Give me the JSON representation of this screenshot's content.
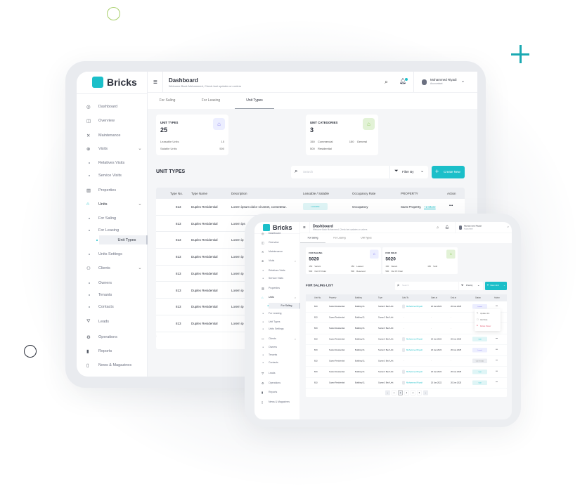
{
  "colors": {
    "accent": "#1bbfc9",
    "purple": "#8b7ff0",
    "green": "#8ccc5a",
    "danger": "#e0526a"
  },
  "decor": {
    "circle_top": "circle-outline-green",
    "plus": "plus-teal",
    "circle_left": "circle-outline-dark"
  },
  "big": {
    "brand": "Bricks",
    "header": {
      "title": "Dashboard",
      "subtitle": "Welcome Back Mohammed, Check last updates on orders",
      "user_name": "Mohammed Riyadi",
      "user_role": "Accountant"
    },
    "sidebar": [
      {
        "label": "Dashboard",
        "icon": "dashboard-icon"
      },
      {
        "label": "Overview",
        "icon": "overview-icon"
      },
      {
        "label": "Maintenance",
        "icon": "maintenance-icon"
      },
      {
        "label": "Visits",
        "icon": "visits-icon",
        "chevron": true
      },
      {
        "label": "Relatives Visits",
        "sub": true
      },
      {
        "label": "Service Visits",
        "sub": true
      },
      {
        "label": "Properties",
        "icon": "properties-icon"
      },
      {
        "label": "Units",
        "icon": "units-icon",
        "chevron": true,
        "active": true
      },
      {
        "label": "For Saling",
        "sub": true
      },
      {
        "label": "For Leasing",
        "sub": true
      },
      {
        "label": "Unit Types",
        "sub": true,
        "selected": true
      },
      {
        "label": "Units Settings",
        "sub": true
      },
      {
        "label": "Clients",
        "icon": "clients-icon",
        "chevron": true
      },
      {
        "label": "Owners",
        "sub": true
      },
      {
        "label": "Tenants",
        "sub": true
      },
      {
        "label": "Contacts",
        "sub": true
      },
      {
        "label": "Leads",
        "icon": "leads-icon"
      },
      {
        "label": "Operations",
        "icon": "operations-icon"
      },
      {
        "label": "Reports",
        "icon": "reports-icon"
      },
      {
        "label": "News & Magazines",
        "icon": "news-icon"
      }
    ],
    "tabs": [
      "For Saling",
      "For Leasing",
      "Unit Types"
    ],
    "active_tab": "Unit Types",
    "cards": [
      {
        "title": "UNIT TYPES",
        "value": "25",
        "rows": [
          [
            "Leasable Units",
            "15"
          ],
          [
            "Salable Units",
            "500"
          ]
        ]
      },
      {
        "title": "UNIT CATEGORIES",
        "value": "3",
        "rows": [
          [
            "150",
            "Commercial",
            "150",
            "General"
          ],
          [
            "500",
            "Residential"
          ]
        ]
      }
    ],
    "list_title": "UNIT TYPES",
    "search_placeholder": "Search",
    "filter_label": "Filter By",
    "create_label": "Create New",
    "columns": [
      "Type No.",
      "Type Name",
      "Description",
      "Leasable / Salable",
      "Occupancy Rate",
      "PROPERTY",
      "Action"
    ],
    "rows": [
      {
        "no": "813",
        "name": "Duplex Residential",
        "desc": "Lorem ipsum dolor sit amet, consetetur.",
        "badge": "Leasable",
        "occ": "Occupancy",
        "prop": "Sans Property,",
        "more": "+3 More",
        "action": "•••"
      },
      {
        "no": "813",
        "name": "Duplex Residential",
        "desc": "Lorem ips"
      },
      {
        "no": "813",
        "name": "Duplex Residential",
        "desc": "Lorem ip"
      },
      {
        "no": "813",
        "name": "Duplex Residential",
        "desc": "Lorem ip"
      },
      {
        "no": "813",
        "name": "Duplex Residential",
        "desc": "Lorem ip"
      },
      {
        "no": "813",
        "name": "Duplex Residential",
        "desc": "Lorem ip"
      },
      {
        "no": "813",
        "name": "Duplex Residential",
        "desc": "Lorem ip"
      },
      {
        "no": "813",
        "name": "Duplex Residential",
        "desc": "Lorem ip"
      }
    ]
  },
  "small": {
    "brand": "Bricks",
    "header": {
      "title": "Dashboard",
      "subtitle": "Welcome Back Mohammed, Check last updates on orders",
      "user_name": "Mohammed Riyadi",
      "user_role": "Accountant"
    },
    "sidebar": [
      {
        "label": "Dashboard",
        "icon": "dashboard-icon"
      },
      {
        "label": "Overview",
        "icon": "overview-icon"
      },
      {
        "label": "Maintenance",
        "icon": "maintenance-icon"
      },
      {
        "label": "Visits",
        "icon": "visits-icon",
        "chevron": true
      },
      {
        "label": "Relatives Visits",
        "sub": true
      },
      {
        "label": "Service Visits",
        "sub": true
      },
      {
        "label": "Properties",
        "icon": "properties-icon"
      },
      {
        "label": "Units",
        "icon": "units-icon",
        "chevron": true,
        "active": true
      },
      {
        "label": "For Saling",
        "sub": true,
        "selected": true
      },
      {
        "label": "For Leasing",
        "sub": true
      },
      {
        "label": "Unit Types",
        "sub": true
      },
      {
        "label": "Units Settings",
        "sub": true
      },
      {
        "label": "Clients",
        "icon": "clients-icon",
        "chevron": true
      },
      {
        "label": "Owners",
        "sub": true
      },
      {
        "label": "Tenants",
        "sub": true
      },
      {
        "label": "Contacts",
        "sub": true
      },
      {
        "label": "Leads",
        "icon": "leads-icon"
      },
      {
        "label": "Operations",
        "icon": "operations-icon"
      },
      {
        "label": "Reports",
        "icon": "reports-icon"
      },
      {
        "label": "News & Magazines",
        "icon": "news-icon"
      }
    ],
    "tabs": [
      "For Saling",
      "For Leasing",
      "Unit Types"
    ],
    "active_tab": "For Saling",
    "cards": [
      {
        "title": "FOR SALING",
        "value": "5020",
        "rows": [
          [
            "150",
            "Vacant",
            "150",
            "Leased"
          ],
          [
            "500",
            "Out Of Order",
            "500",
            "Reserved"
          ]
        ]
      },
      {
        "title": "FOR SOLD",
        "value": "5020",
        "rows": [
          [
            "150",
            "Vacant",
            "150",
            "Sold"
          ],
          [
            "500",
            "Out Of Order"
          ]
        ]
      }
    ],
    "list_title": "FOR SALING LIST",
    "search_placeholder": "Search",
    "filter_label": "Priority",
    "create_label": "New Unit",
    "columns": [
      "Unit No.",
      "Property",
      "Building",
      "Type",
      "Sold To",
      "Start at",
      "End at",
      "Status",
      "Action"
    ],
    "rows": [
      {
        "no": "813",
        "prop": "Suzan Residential",
        "bld": "Building 01",
        "type": "Suzan 3 Bed Unit",
        "to": "Mohammed Riyadi",
        "start": "20 Jan 2022",
        "end": "20 Jan 2025",
        "status": "Leased",
        "action": "•••"
      },
      {
        "no": "813",
        "prop": "Suzan Residential",
        "bld": "Building 01",
        "type": "Suzan 3 Bed Unit",
        "to": "-",
        "start": "-",
        "end": "-",
        "status": "",
        "action": "•••"
      },
      {
        "no": "813",
        "prop": "Suzan Residential",
        "bld": "Building 01",
        "type": "Suzan 3 Bed Unit",
        "to": "-",
        "start": "-",
        "end": "-",
        "status": "",
        "action": "•••"
      },
      {
        "no": "813",
        "prop": "Suzan Residential",
        "bld": "Building 01",
        "type": "Suzan 3 Bed Unit",
        "to": "Mohammed Riyadi",
        "start": "20 Jan 2022",
        "end": "20 Jan 2025",
        "status": "Sold",
        "action": "•••"
      },
      {
        "no": "813",
        "prop": "Suzan Residential",
        "bld": "Building 01",
        "type": "Suzan 3 Bed Unit",
        "to": "Mohammed Riyadi",
        "start": "20 Jan 2022",
        "end": "20 Jan 2025",
        "status": "Leased",
        "action": "•••"
      },
      {
        "no": "813",
        "prop": "Suzan Residential",
        "bld": "Building 01",
        "type": "Suzan 3 Bed Unit",
        "to": "-",
        "start": "-",
        "end": "-",
        "status": "Out Of Order",
        "action": "•••"
      },
      {
        "no": "813",
        "prop": "Suzan Residential",
        "bld": "Building 01",
        "type": "Suzan 3 Bed Unit",
        "to": "Mohammed Riyadi",
        "start": "20 Jan 2022",
        "end": "20 Jan 2025",
        "status": "Sold",
        "action": "•••"
      },
      {
        "no": "813",
        "prop": "Suzan Residential",
        "bld": "Building 01",
        "type": "Suzan 3 Bed Unit",
        "to": "Mohammed Riyadi",
        "start": "20 Jan 2022",
        "end": "20 Jan 2025",
        "status": "Sold",
        "action": "•••"
      }
    ],
    "row_menu": [
      "Update Unit",
      "Add Note",
      "Delete Owner"
    ],
    "pagination": [
      "‹",
      "1",
      "2",
      "3",
      "4",
      "5",
      "›"
    ],
    "current_page": "2"
  }
}
